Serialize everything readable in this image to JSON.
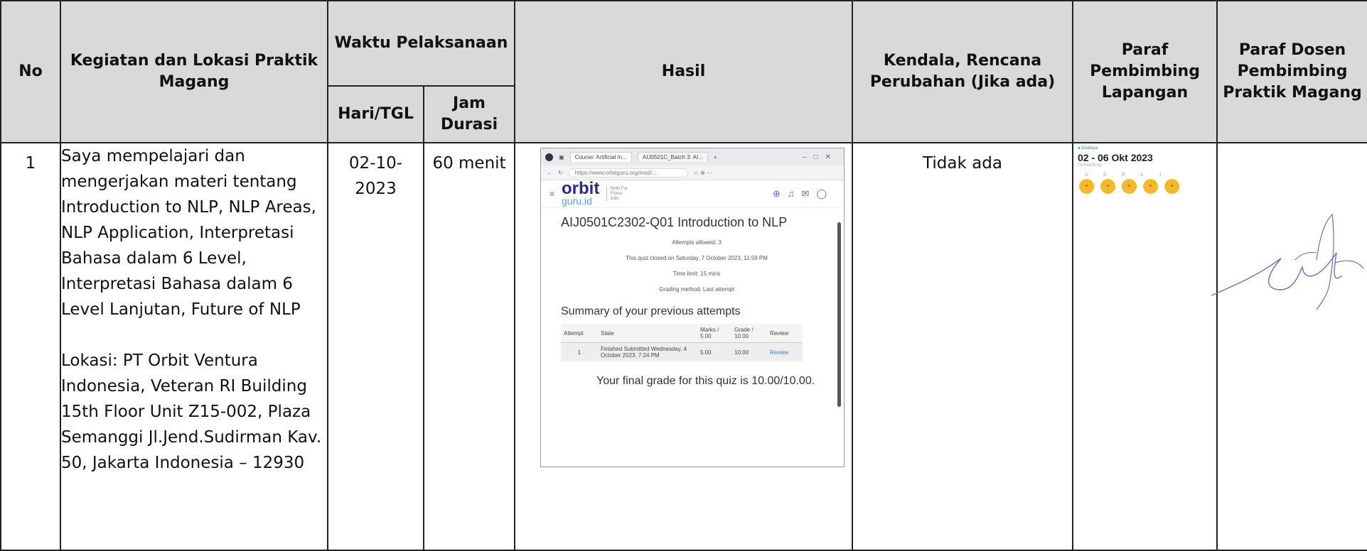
{
  "headers": {
    "no": "No",
    "kegiatan": "Kegiatan dan Lokasi Praktik Magang",
    "waktu": "Waktu Pelaksanaan",
    "hari": "Hari/TGL",
    "jam": "Jam Durasi",
    "hasil": "Hasil",
    "kendala": "Kendala, Rencana Perubahan (Jika ada)",
    "paraf_lapangan": "Paraf Pembimbing Lapangan",
    "paraf_dosen": "Paraf Dosen Pembimbing Praktik Magang"
  },
  "row": {
    "no": "1",
    "kegiatan": "Saya mempelajari dan mengerjakan materi tentang Introduction to NLP, NLP Areas, NLP Application, Interpretasi Bahasa dalam 6 Level, Interpretasi Bahasa dalam 6 Level Lanjutan, Future of NLP",
    "lokasi": "Lokasi: PT Orbit Ventura Indonesia, Veteran RI Building 15th Floor Unit Z15-002, Plaza Semanggi Jl.Jend.Sudirman Kav. 50, Jakarta Indonesia – 12930",
    "tanggal": "02-10-2023",
    "durasi": "60 menit",
    "kendala": "Tidak ada"
  },
  "screenshot": {
    "tab1": "Course: Artificial In...",
    "tab2": "AIJ0501C_Batch 3: AI...",
    "url": "https://www.orbitguru.org/mod/...",
    "logo_top": "orbit",
    "logo_bottom": "guru.id",
    "tagline": "Skills For Future Jobs",
    "quiz_title": "AIJ0501C2302-Q01 Introduction to NLP",
    "attempts_allowed": "Attempts allowed: 3",
    "closed_on": "This quiz closed on Saturday, 7 October 2023, 11:59 PM",
    "time_limit": "Time limit: 15 mins",
    "grading": "Grading method: Last attempt",
    "summary_title": "Summary of your previous attempts",
    "table_headers": [
      "Attempt",
      "State",
      "Marks / 5.00",
      "Grade / 10.00",
      "Review"
    ],
    "attempt_row": {
      "attempt": "1",
      "state": "Finished Submitted Wednesday, 4 October 2023, 7:24 PM",
      "marks": "5.00",
      "grade": "10.00",
      "review": "Review"
    },
    "final_grade": "Your final grade for this quiz is 10.00/10.00."
  },
  "paraf": {
    "status": "Disetujui",
    "date_range": "02 - 06 Okt 2023",
    "sub": "Pembimbing",
    "days": [
      "S",
      "S",
      "R",
      "K",
      "J"
    ],
    "emoji_count": 5
  },
  "signature": "signature"
}
